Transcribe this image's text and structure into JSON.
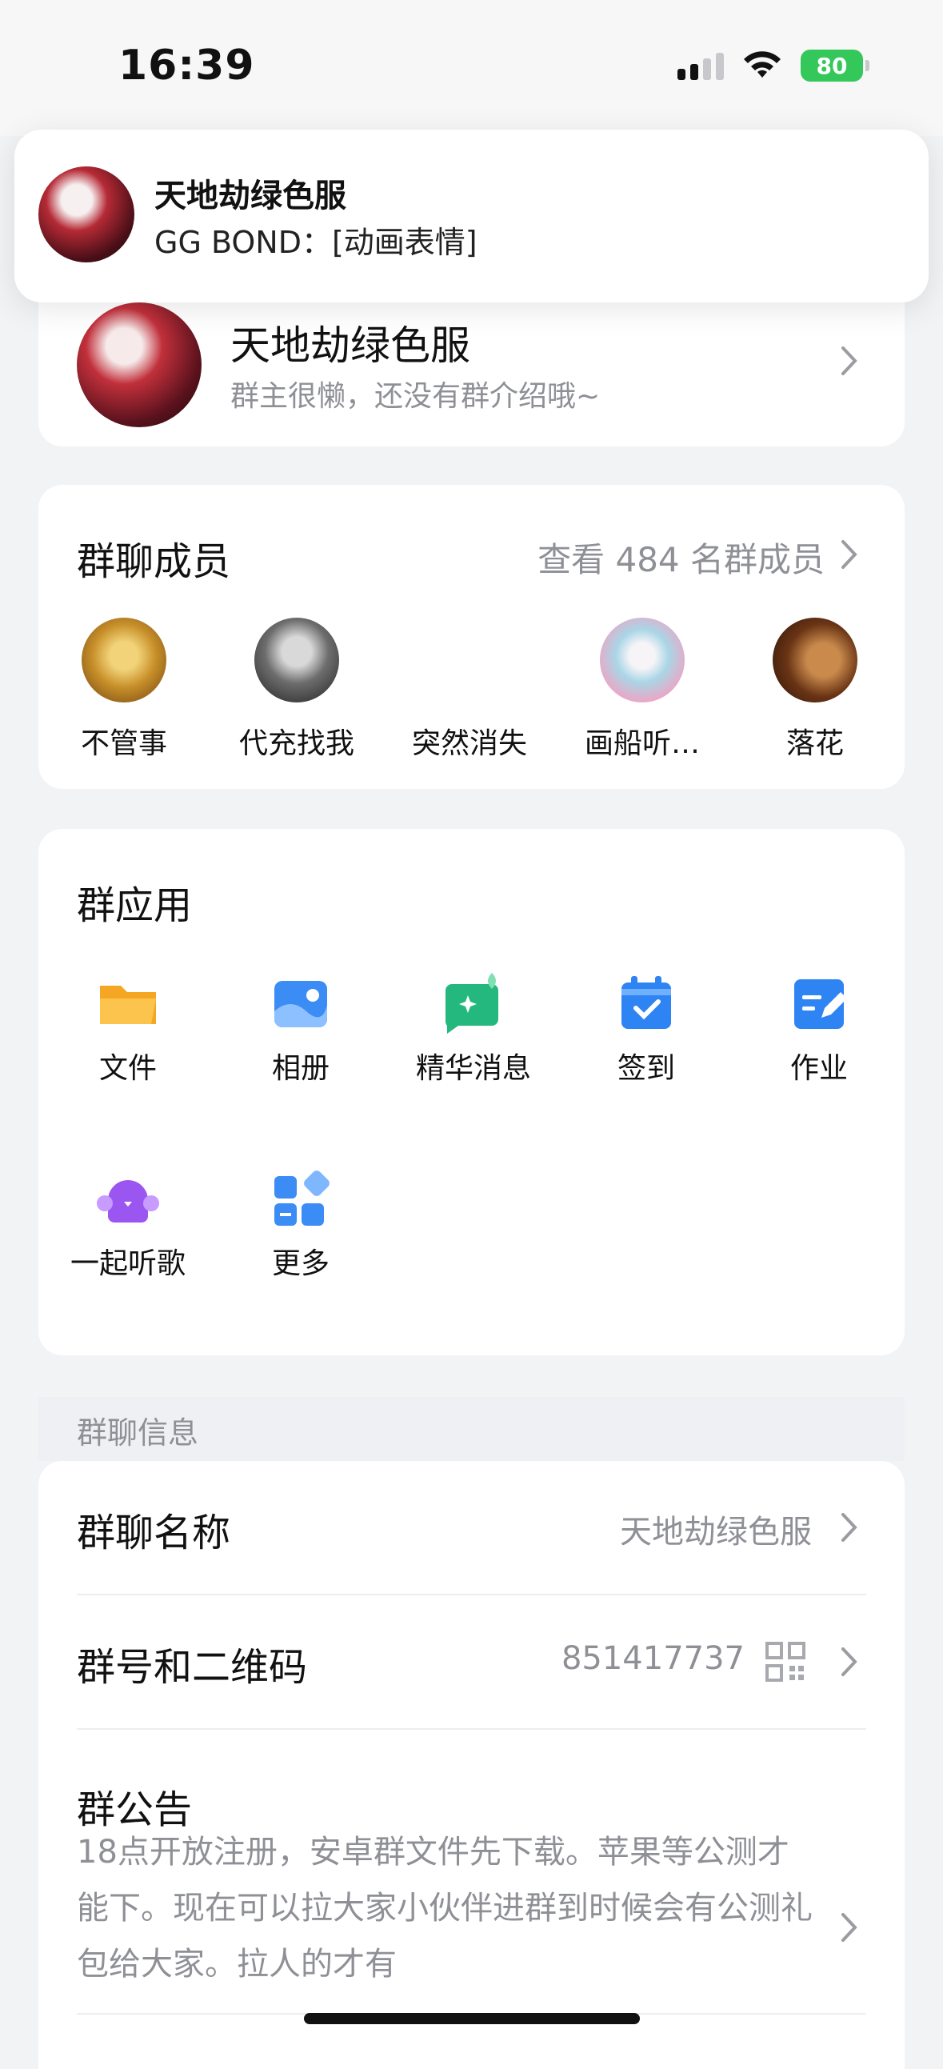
{
  "status_bar": {
    "time": "16:39",
    "battery": "80"
  },
  "notification": {
    "title": "天地劫绿色服",
    "body": "GG BOND：[动画表情]"
  },
  "group": {
    "name": "天地劫绿色服",
    "description": "群主很懒，还没有群介绍哦~"
  },
  "members": {
    "title": "群聊成员",
    "view_all": "查看 484 名群成员",
    "items": [
      {
        "name": "不管事"
      },
      {
        "name": "代充找我"
      },
      {
        "name": "突然消失"
      },
      {
        "name": "画船听…"
      },
      {
        "name": "落花"
      }
    ]
  },
  "apps": {
    "title": "群应用",
    "items": [
      {
        "label": "文件",
        "icon": "folder-icon",
        "color": "#f7b23b"
      },
      {
        "label": "相册",
        "icon": "album-icon",
        "color": "#3b8cf5"
      },
      {
        "label": "精华消息",
        "icon": "featured-message-icon",
        "color": "#2dbd8d"
      },
      {
        "label": "签到",
        "icon": "calendar-check-icon",
        "color": "#2f84f4"
      },
      {
        "label": "作业",
        "icon": "homework-edit-icon",
        "color": "#2f84f4"
      },
      {
        "label": "一起听歌",
        "icon": "listen-together-icon",
        "color": "#9b56f2"
      },
      {
        "label": "更多",
        "icon": "more-apps-icon",
        "color": "#3b8cf5"
      }
    ]
  },
  "info": {
    "section_label": "群聊信息",
    "name_label": "群聊名称",
    "name_value": "天地劫绿色服",
    "number_label": "群号和二维码",
    "number_value": "851417737",
    "notice_label": "群公告",
    "notice_text": "18点开放注册，安卓群文件先下载。苹果等公测才能下。现在可以拉大家小伙伴进群到时候会有公测礼包给大家。拉人的才有"
  }
}
